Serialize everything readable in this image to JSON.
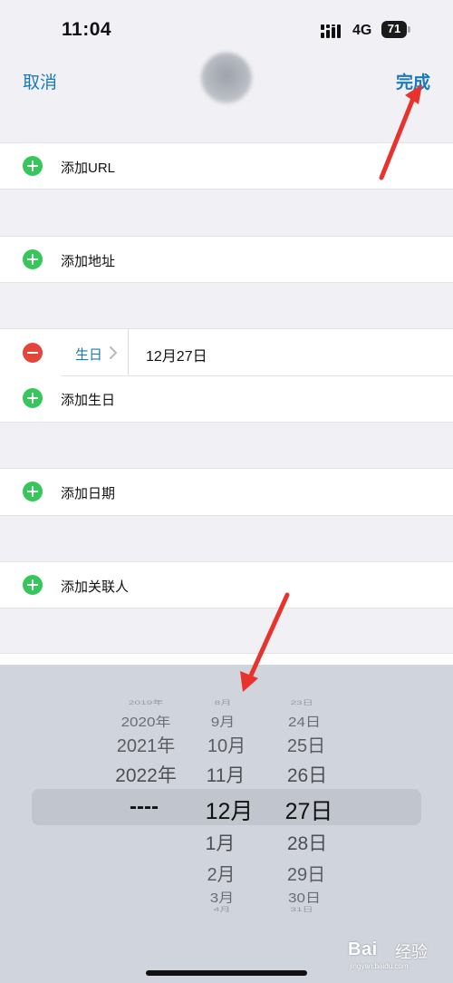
{
  "status_bar": {
    "time": "11:04",
    "network": "4G",
    "battery": "71"
  },
  "nav": {
    "cancel_label": "取消",
    "done_label": "完成"
  },
  "rows": {
    "add_url": "添加URL",
    "add_address": "添加地址",
    "birthday_type": "生日",
    "birthday_value": "12月27日",
    "add_birthday": "添加生日",
    "add_date": "添加日期",
    "add_related": "添加关联人"
  },
  "picker": {
    "year_column": [
      "2019年",
      "2020年",
      "2021年",
      "2022年",
      "----"
    ],
    "month_column": [
      "8月",
      "9月",
      "10月",
      "11月",
      "12月",
      "1月",
      "2月",
      "3月",
      "4月"
    ],
    "day_column": [
      "23日",
      "24日",
      "25日",
      "26日",
      "27日",
      "28日",
      "29日",
      "30日",
      "31日"
    ],
    "selected": {
      "year": "----",
      "month": "12月",
      "day": "27日"
    }
  },
  "watermark": {
    "logo": "Bai",
    "text": "经验",
    "sub": "jingyan.baidu.com"
  },
  "colors": {
    "accent": "#1a7ab8",
    "add_green": "#35c759",
    "remove_red": "#e5443a",
    "annotation_arrow": "#e8322d"
  }
}
